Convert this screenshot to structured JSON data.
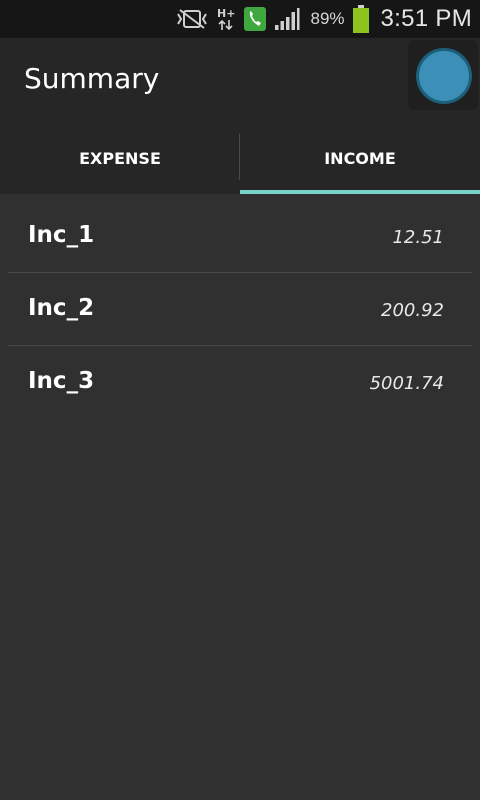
{
  "status_bar": {
    "battery_percent": "89%",
    "time": "3:51 PM",
    "network_label": "H+",
    "icons": [
      "vibrate-mute-icon",
      "network-hplus-icon",
      "phone-call-icon",
      "signal-icon",
      "battery-icon"
    ],
    "colors": {
      "phone_green": "#3fa83f",
      "battery_green": "#8ec21e"
    }
  },
  "app": {
    "title": "Summary",
    "fab_color": "#3c90b8"
  },
  "tabs": [
    {
      "label": "EXPENSE",
      "selected": false
    },
    {
      "label": "INCOME",
      "selected": true
    }
  ],
  "indicator_color": "#7ad3c8",
  "items": [
    {
      "label": "Inc_1",
      "value": "12.51"
    },
    {
      "label": "Inc_2",
      "value": "200.92"
    },
    {
      "label": "Inc_3",
      "value": "5001.74"
    }
  ]
}
